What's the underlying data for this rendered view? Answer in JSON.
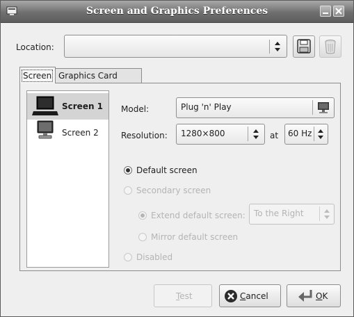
{
  "window": {
    "title": "Screen and Graphics Preferences",
    "menu_icon": "window-menu-icon",
    "controls": [
      "minimize-icon",
      "close-icon"
    ]
  },
  "location": {
    "label": "Location:",
    "value": "",
    "save_icon": "floppy-disk-icon",
    "delete_icon": "trash-can-icon"
  },
  "tabs": [
    {
      "label": "Screen",
      "active": true
    },
    {
      "label": "Graphics Card",
      "active": false
    }
  ],
  "screens": [
    {
      "label": "Screen 1",
      "icon": "laptop-icon",
      "selected": true
    },
    {
      "label": "Screen 2",
      "icon": "monitor-icon",
      "selected": false
    }
  ],
  "model": {
    "label": "Model:",
    "value": "Plug 'n' Play",
    "icon": "monitor-icon"
  },
  "resolution": {
    "label": "Resolution:",
    "value": "1280×800",
    "at_label": "at",
    "refresh": "60 Hz"
  },
  "options": {
    "default_screen": {
      "label": "Default screen",
      "checked": true,
      "enabled": true
    },
    "secondary_screen": {
      "label": "Secondary screen",
      "checked": false,
      "enabled": false
    },
    "extend": {
      "label": "Extend default screen:",
      "checked": true,
      "enabled": false,
      "position": "To the Right"
    },
    "mirror": {
      "label": "Mirror default screen",
      "checked": false,
      "enabled": false
    },
    "disabled": {
      "label": "Disabled",
      "checked": false,
      "enabled": false
    }
  },
  "buttons": {
    "test": {
      "accel": "T",
      "rest": "est",
      "enabled": false
    },
    "cancel": {
      "accel": "C",
      "rest": "ancel",
      "icon": "cancel-x-icon"
    },
    "ok": {
      "accel": "O",
      "rest": "K",
      "icon": "ok-arrow-icon"
    }
  },
  "colors": {
    "title_bar": "#6f6f6f",
    "selection": "#d4d4d4",
    "disabled_text": "#b4b4b4"
  }
}
